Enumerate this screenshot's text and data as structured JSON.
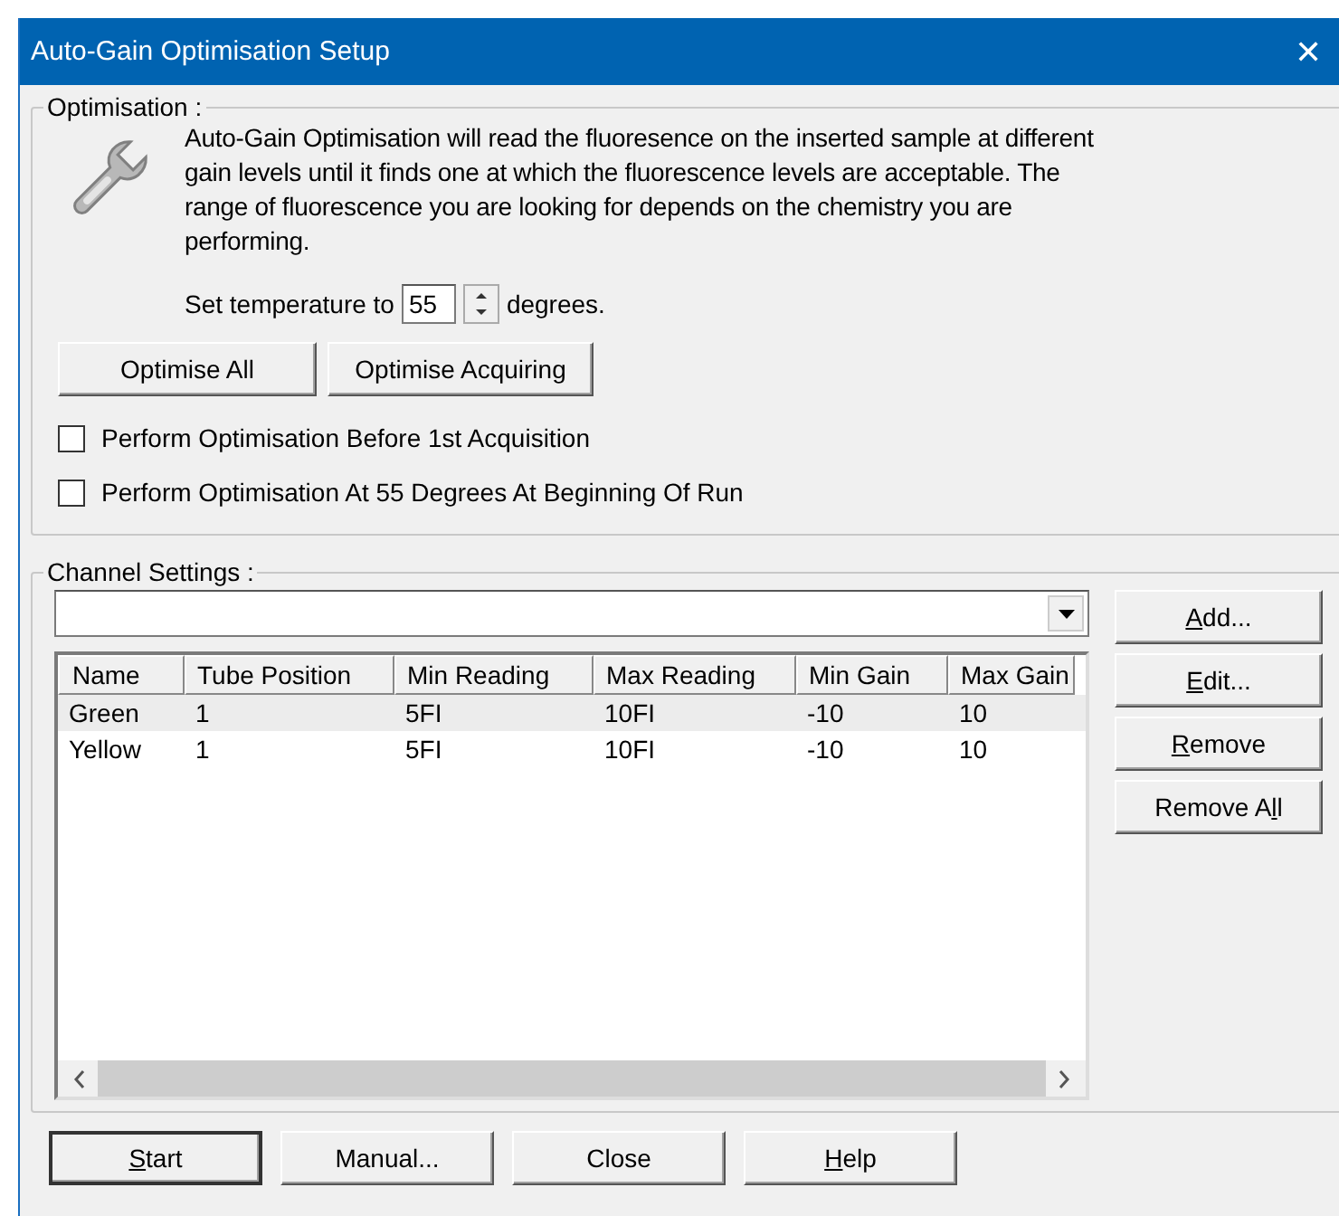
{
  "window": {
    "title": "Auto-Gain Optimisation Setup",
    "close": "✕"
  },
  "optimisation": {
    "label": "Optimisation :",
    "description": "Auto-Gain Optimisation will read the fluoresence on the inserted sample at different gain levels until it finds one at which the fluorescence levels are acceptable. The range of fluorescence you are looking for depends on the chemistry you are performing.",
    "temperature": {
      "label": "Set temperature to",
      "value": "55",
      "unit": "degrees."
    },
    "buttons": [
      {
        "label": "Optimise All"
      },
      {
        "label": "Optimise Acquiring"
      }
    ],
    "checkboxes": [
      {
        "label": "Perform Optimisation Before 1st Acquisition",
        "checked": false
      },
      {
        "label": "Perform Optimisation At 55 Degrees At Beginning Of Run",
        "checked": false
      }
    ]
  },
  "channels": {
    "label": "Channel Settings :",
    "columns": [
      "Name",
      "Tube Position",
      "Min Reading",
      "Max Reading",
      "Min Gain",
      "Max Gain"
    ],
    "rows": [
      {
        "cells": [
          "Green",
          "1",
          "5FI",
          "10FI",
          "-10",
          "10"
        ],
        "selected": true
      },
      {
        "cells": [
          "Yellow",
          "1",
          "5FI",
          "10FI",
          "-10",
          "10"
        ],
        "selected": false
      }
    ],
    "buttons": [
      {
        "key": "A",
        "label_after": "dd..."
      },
      {
        "key": "E",
        "label_after": "dit..."
      },
      {
        "key": "R",
        "label_after": "emove"
      },
      {
        "label_before": "Remove A",
        "key": "l",
        "label_after": "l"
      }
    ]
  },
  "footer_buttons": [
    {
      "key": "S",
      "label_after": "tart"
    },
    {
      "label_before": "Manual..."
    },
    {
      "label_before": "Close"
    },
    {
      "key": "H",
      "label_after": "elp"
    }
  ]
}
